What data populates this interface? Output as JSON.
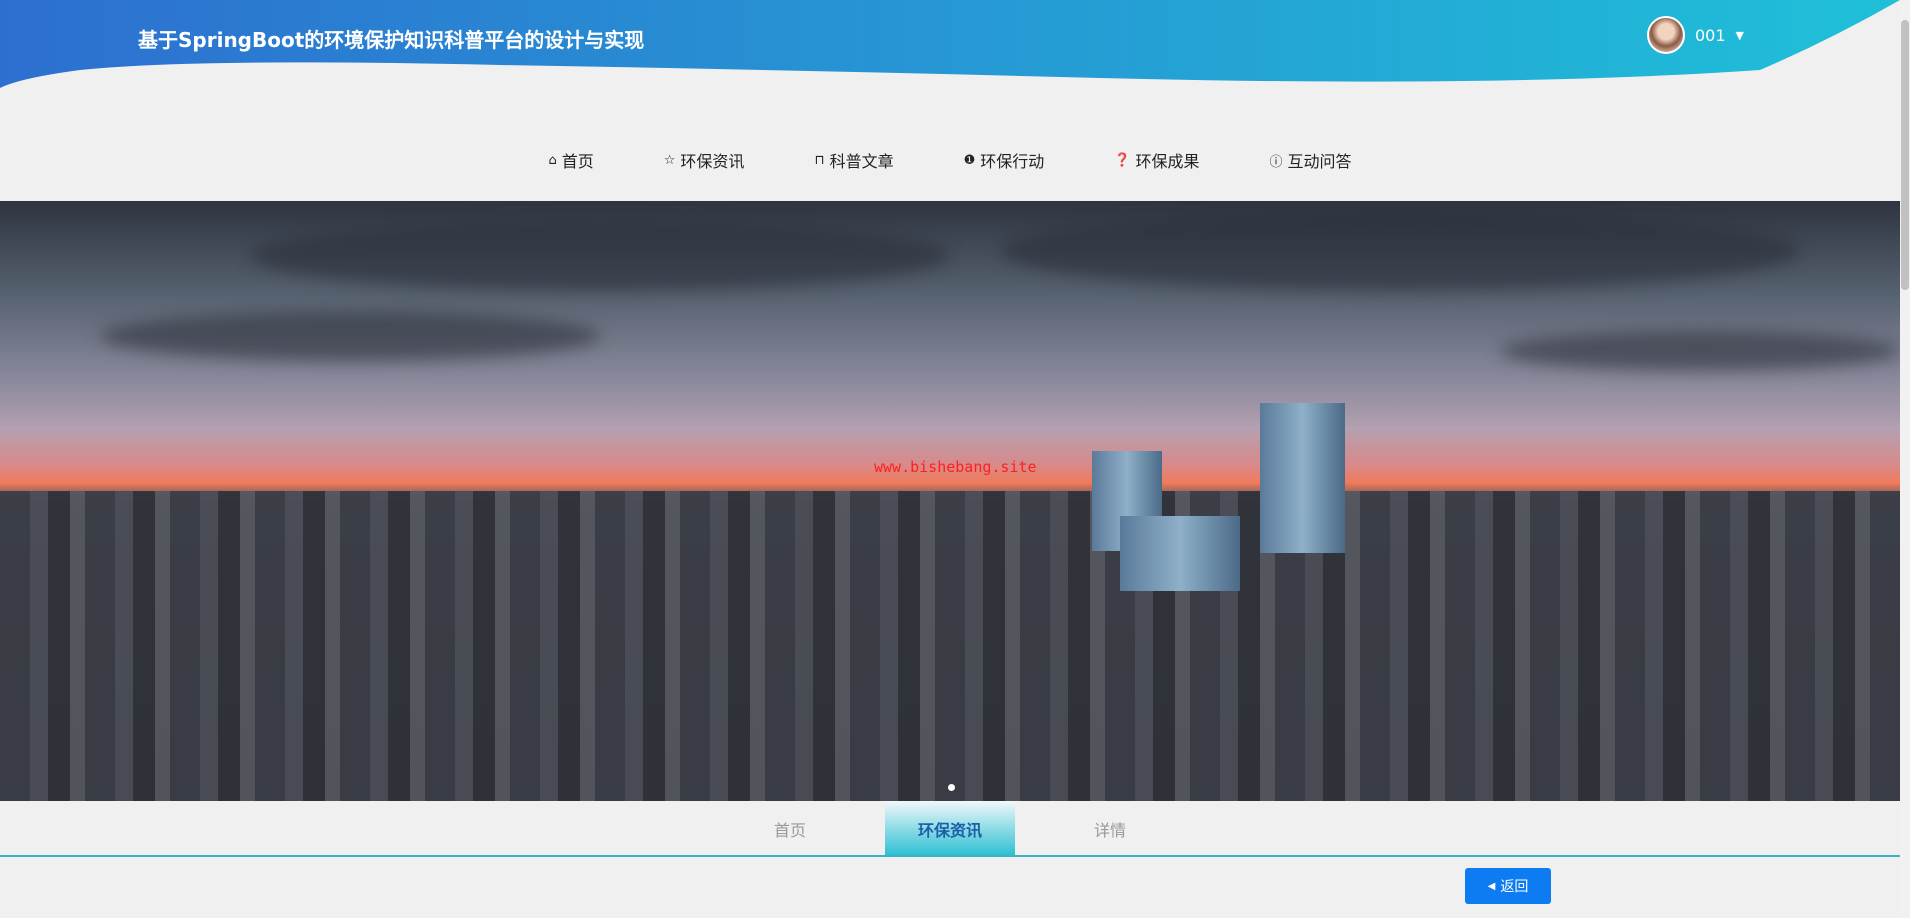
{
  "header": {
    "title": "基于SpringBoot的环境保护知识科普平台的设计与实现",
    "username": "001",
    "dropdown_icon": "▼"
  },
  "nav": [
    {
      "icon": "⌂",
      "label": "首页"
    },
    {
      "icon": "☆",
      "label": "环保资讯"
    },
    {
      "icon": "⊓",
      "label": "科普文章"
    },
    {
      "icon": "❶",
      "label": "环保行动"
    },
    {
      "icon": "❓",
      "label": "环保成果"
    },
    {
      "icon": "ⓘ",
      "label": "互动问答"
    }
  ],
  "banner": {
    "watermark": "www.bishebang.site"
  },
  "breadcrumb": [
    {
      "label": "首页"
    },
    {
      "label": "环保资讯"
    },
    {
      "label": "详情"
    }
  ],
  "back_button": {
    "icon": "◀",
    "label": "返回"
  },
  "colors": {
    "header_start": "#2d6fd0",
    "header_end": "#1fc0d8",
    "accent": "#0d7cf2"
  }
}
